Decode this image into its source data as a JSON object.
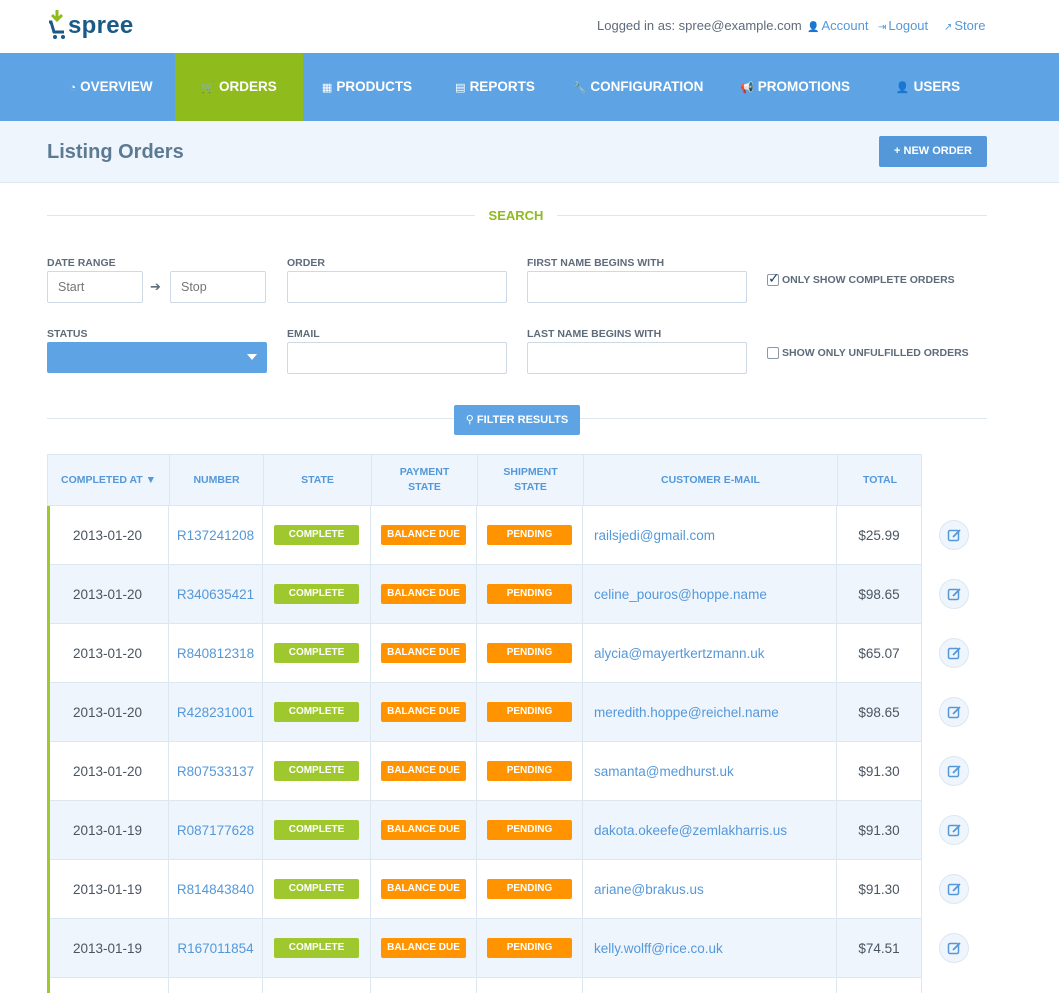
{
  "brand": {
    "name": "spree"
  },
  "header": {
    "login_label": "Logged in as: spree@example.com",
    "links": [
      {
        "label": "Account",
        "icon": "user-icon"
      },
      {
        "label": "Logout",
        "icon": "sign-out-icon"
      },
      {
        "label": "Store",
        "icon": "external-link-icon"
      }
    ]
  },
  "nav": {
    "items": [
      {
        "label": "Overview",
        "icon": "dashboard-icon"
      },
      {
        "label": "Orders",
        "icon": "cart-icon",
        "active": true
      },
      {
        "label": "Products",
        "icon": "grid-icon"
      },
      {
        "label": "Reports",
        "icon": "file-icon"
      },
      {
        "label": "Configuration",
        "icon": "wrench-icon"
      },
      {
        "label": "Promotions",
        "icon": "bullhorn-icon"
      },
      {
        "label": "Users",
        "icon": "user-icon"
      }
    ]
  },
  "page": {
    "title": "Listing Orders",
    "new_order_label": "New Order"
  },
  "search": {
    "title": "Search",
    "date_range_label": "Date Range",
    "start_placeholder": "Start",
    "stop_placeholder": "Stop",
    "order_label": "Order",
    "first_name_label": "First Name Begins With",
    "status_label": "Status",
    "status_value": "",
    "email_label": "Email",
    "last_name_label": "Last Name Begins With",
    "only_complete_label": "Only Show Complete Orders",
    "only_complete_checked": true,
    "only_unfulfilled_label": "Show Only Unfulfilled Orders",
    "only_unfulfilled_checked": false,
    "filter_label": "Filter Results"
  },
  "table": {
    "headers": {
      "completed_at": "Completed At",
      "number": "Number",
      "state": "State",
      "payment_state_1": "Payment",
      "payment_state_2": "State",
      "shipment_state_1": "Shipment",
      "shipment_state_2": "State",
      "email": "Customer E-Mail",
      "total": "Total"
    },
    "rows": [
      {
        "date": "2013-01-20",
        "number": "R137241208",
        "state": "Complete",
        "payment": "Balance Due",
        "shipment": "Pending",
        "email": "railsjedi@gmail.com",
        "total": "$25.99"
      },
      {
        "date": "2013-01-20",
        "number": "R340635421",
        "state": "Complete",
        "payment": "Balance Due",
        "shipment": "Pending",
        "email": "celine_pouros@hoppe.name",
        "total": "$98.65"
      },
      {
        "date": "2013-01-20",
        "number": "R840812318",
        "state": "Complete",
        "payment": "Balance Due",
        "shipment": "Pending",
        "email": "alycia@mayertkertzmann.uk",
        "total": "$65.07"
      },
      {
        "date": "2013-01-20",
        "number": "R428231001",
        "state": "Complete",
        "payment": "Balance Due",
        "shipment": "Pending",
        "email": "meredith.hoppe@reichel.name",
        "total": "$98.65"
      },
      {
        "date": "2013-01-20",
        "number": "R807533137",
        "state": "Complete",
        "payment": "Balance Due",
        "shipment": "Pending",
        "email": "samanta@medhurst.uk",
        "total": "$91.30"
      },
      {
        "date": "2013-01-19",
        "number": "R087177628",
        "state": "Complete",
        "payment": "Balance Due",
        "shipment": "Pending",
        "email": "dakota.okeefe@zemlakharris.us",
        "total": "$91.30"
      },
      {
        "date": "2013-01-19",
        "number": "R814843840",
        "state": "Complete",
        "payment": "Balance Due",
        "shipment": "Pending",
        "email": "ariane@brakus.us",
        "total": "$91.30"
      },
      {
        "date": "2013-01-19",
        "number": "R167011854",
        "state": "Complete",
        "payment": "Balance Due",
        "shipment": "Pending",
        "email": "kelly.wolff@rice.co.uk",
        "total": "$74.51"
      },
      {
        "date": "",
        "number": "",
        "state": "",
        "payment": "",
        "shipment": "",
        "email": "",
        "total": ""
      }
    ]
  },
  "colors": {
    "primary": "#5ea4e5",
    "accent_green": "#8fbb1d",
    "badge_green": "#9fc82f",
    "badge_orange": "#ff9300",
    "link": "#5498da"
  }
}
